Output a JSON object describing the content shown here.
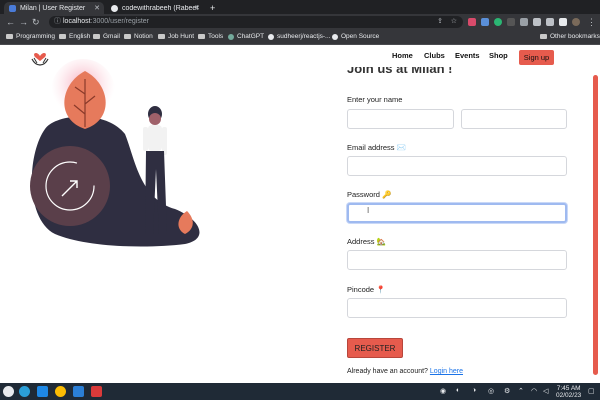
{
  "browser": {
    "tabs": [
      {
        "title": "Milan | User Register",
        "active": true,
        "favicon_color": "#4a7bd8"
      },
      {
        "title": "codewithrabeeh (Rabeeh Eb",
        "active": false,
        "favicon_color": "#e8eaed"
      }
    ],
    "new_tab": "+",
    "url_host": "localhost",
    "url_path": ":3000/user/register",
    "back": "←",
    "forward": "→",
    "reload": "↻",
    "bookmarks": [
      {
        "label": "Programming",
        "type": "folder"
      },
      {
        "label": "English",
        "type": "folder"
      },
      {
        "label": "Gmail",
        "type": "folder"
      },
      {
        "label": "Notion",
        "type": "folder"
      },
      {
        "label": "Job Hunt",
        "type": "folder"
      },
      {
        "label": "Tools",
        "type": "folder"
      },
      {
        "label": "ChatGPT",
        "type": "link"
      },
      {
        "label": "sudheerj/reactjs-...",
        "type": "link"
      },
      {
        "label": "Open Source",
        "type": "link"
      }
    ],
    "other_bookmarks": "Other bookmarks"
  },
  "site": {
    "nav": [
      "Home",
      "Clubs",
      "Events",
      "Shop"
    ],
    "signup": "Sign up",
    "heading": "Join us at Milan !",
    "name_label": "Enter your name",
    "email_label": "Email address ✉️",
    "password_label": "Password 🔑",
    "address_label": "Address 🏡",
    "pincode_label": "Pincode 📍",
    "register_button": "REGISTER",
    "already_text": "Already have an account?",
    "login_link": "Login here",
    "accent_color": "#e65b4d"
  },
  "taskbar": {
    "time": "7:45 AM",
    "date": "02/02/23"
  }
}
